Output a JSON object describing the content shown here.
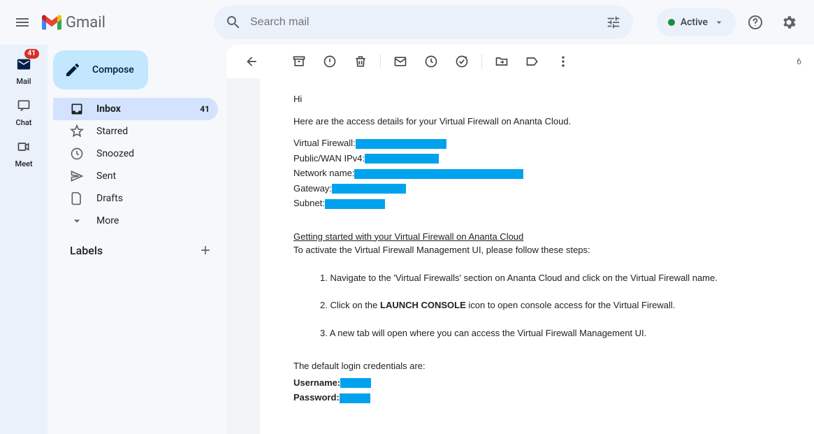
{
  "header": {
    "app_name": "Gmail",
    "search_placeholder": "Search mail",
    "status_label": "Active"
  },
  "rail": {
    "mail": {
      "label": "Mail",
      "badge": "41"
    },
    "chat": {
      "label": "Chat"
    },
    "meet": {
      "label": "Meet"
    }
  },
  "sidebar": {
    "compose_label": "Compose",
    "nav": [
      {
        "icon": "inbox",
        "label": "Inbox",
        "count": "41",
        "active": true
      },
      {
        "icon": "star",
        "label": "Starred"
      },
      {
        "icon": "clock",
        "label": "Snoozed"
      },
      {
        "icon": "send",
        "label": "Sent"
      },
      {
        "icon": "file",
        "label": "Drafts"
      },
      {
        "icon": "chev",
        "label": "More"
      }
    ],
    "labels_header": "Labels"
  },
  "toolbar": {
    "right_text": "6"
  },
  "email": {
    "greeting": "Hi",
    "intro": "Here are the access details for your Virtual Firewall on Ananta Cloud.",
    "details": {
      "vf_label": "Virtual Firewall:",
      "wan_label": "Public/WAN IPv4:",
      "net_label": "Network name:",
      "gw_label": "Gateway:",
      "sub_label": "Subnet:"
    },
    "getting_started_title": "Getting started with your Virtual Firewall on Ananta Cloud",
    "gs_subtitle": "To activate the Virtual Firewall Management UI, please follow these steps:",
    "steps": {
      "s1": "1. Navigate to the 'Virtual Firewalls' section on Ananta Cloud and click on the Virtual Firewall name.",
      "s2_a": "2. Click on the ",
      "s2_b": "LAUNCH CONSOLE",
      "s2_c": " icon to open console access for the Virtual Firewall.",
      "s3": "3. A new tab will open where you can access the Virtual Firewall Management UI."
    },
    "cred_intro": "The default login credentials are:",
    "cred_user_label": "Username:",
    "cred_pass_label": "Password:"
  }
}
